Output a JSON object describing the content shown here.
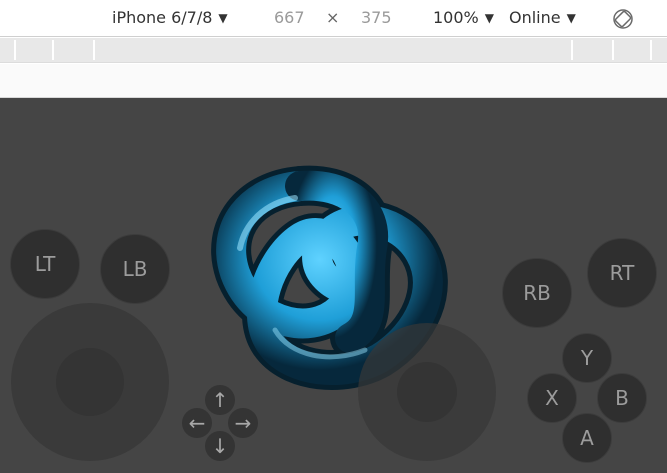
{
  "toolbar": {
    "device": "iPhone 6/7/8",
    "width": "667",
    "times": "×",
    "height": "375",
    "zoom": "100%",
    "throttle": "Online",
    "caret": "▼",
    "rotate_icon": "rotate-icon"
  },
  "game": {
    "scene": {
      "object_icon": "torus-knot",
      "object_color": "#2aaee8"
    },
    "shoulder_buttons": {
      "lt": "LT",
      "lb": "LB",
      "rb": "RB",
      "rt": "RT"
    },
    "face_buttons": {
      "y": "Y",
      "x": "X",
      "b": "B",
      "a": "A"
    },
    "dpad": {
      "up": "↑",
      "left": "←",
      "right": "→",
      "down": "↓"
    },
    "colors": {
      "background": "#454545",
      "button": "#2f2f2f",
      "label": "#9c9c9c"
    }
  }
}
